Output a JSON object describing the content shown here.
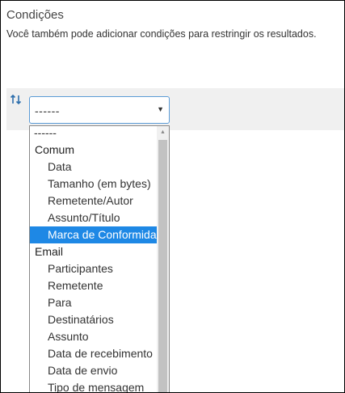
{
  "section": {
    "title": "Condições",
    "description": "Você também pode adicionar condições para restringir os resultados."
  },
  "condition": {
    "sort_icon": "sort-arrows-icon",
    "selected_value": "------"
  },
  "dropdown": {
    "options": [
      {
        "label": "------",
        "kind": "first"
      },
      {
        "label": "Comum",
        "kind": "group"
      },
      {
        "label": "Data",
        "kind": "item"
      },
      {
        "label": "Tamanho (em bytes)",
        "kind": "item"
      },
      {
        "label": "Remetente/Autor",
        "kind": "item"
      },
      {
        "label": "Assunto/Título",
        "kind": "item"
      },
      {
        "label": "Marca de Conformidade",
        "kind": "item",
        "selected": true
      },
      {
        "label": "Email",
        "kind": "group"
      },
      {
        "label": "Participantes",
        "kind": "item"
      },
      {
        "label": "Remetente",
        "kind": "item"
      },
      {
        "label": "Para",
        "kind": "item"
      },
      {
        "label": "Destinatários",
        "kind": "item"
      },
      {
        "label": "Assunto",
        "kind": "item"
      },
      {
        "label": "Data de recebimento",
        "kind": "item"
      },
      {
        "label": "Data de envio",
        "kind": "item"
      },
      {
        "label": "Tipo de mensagem",
        "kind": "item"
      }
    ]
  },
  "colors": {
    "accent": "#1e88e5",
    "select_border": "#5b9bd5",
    "band": "#f0f0f0",
    "icon": "#2e6fad"
  }
}
